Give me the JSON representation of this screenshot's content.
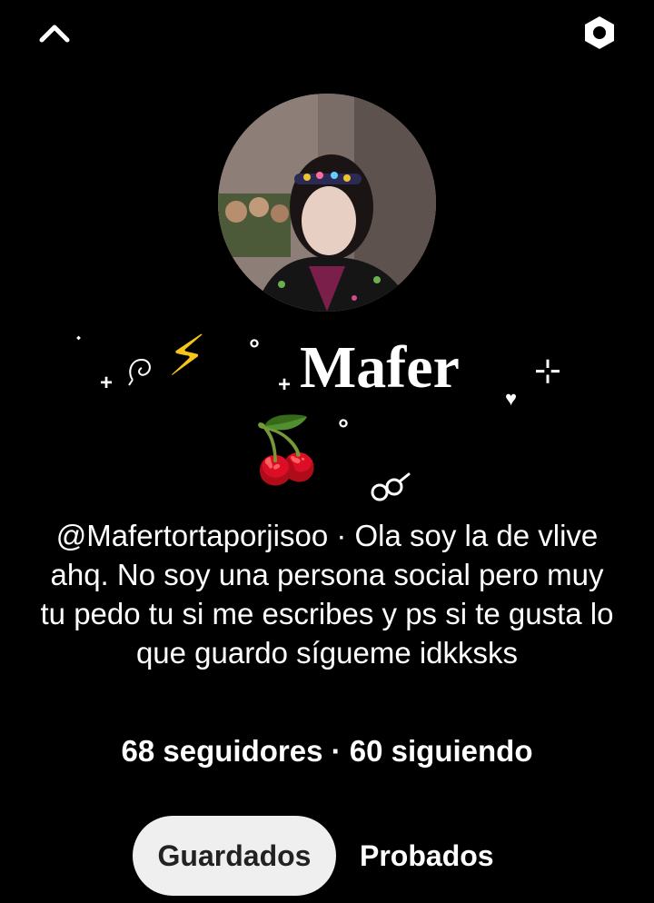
{
  "header": {
    "back_icon": "chevron-up-icon",
    "settings_icon": "settings-hexagon-icon"
  },
  "profile": {
    "avatar_icon": "profile-photo",
    "name": "Mafer",
    "name_decorations": [
      "⚡",
      "🍒"
    ],
    "bio": "@Mafertortaporjisoo · Ola soy la de vlive ahq. No soy una persona social pero muy tu pedo tu si me escribes y ps si te gusta lo que guardo sígueme idkksks",
    "stats": {
      "followers": "68 seguidores",
      "separator": " · ",
      "following": "60 siguiendo"
    }
  },
  "tabs": [
    {
      "label": "Guardados",
      "active": true
    },
    {
      "label": "Probados",
      "active": false
    }
  ],
  "colors": {
    "background": "#000000",
    "text": "#ffffff",
    "active_tab_bg": "#efefef",
    "active_tab_text": "#222222",
    "lightning": "#f5c518",
    "cherry": "#e3191f"
  }
}
